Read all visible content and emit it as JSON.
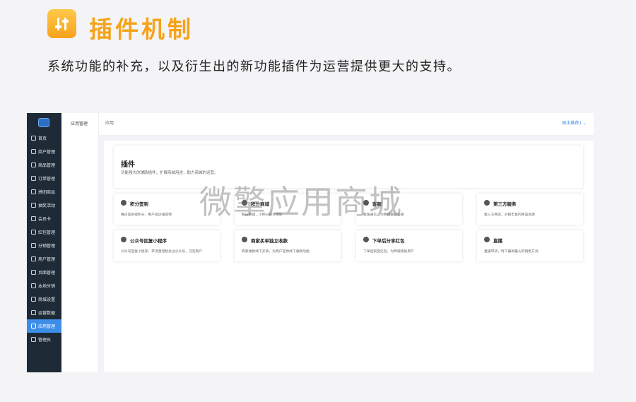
{
  "header": {
    "icon": "sliders-icon",
    "title": "插件机制",
    "subtitle": "系统功能的补充，以及衍生出的新功能插件为运营提供更大的支持。"
  },
  "sidebar": {
    "items": [
      {
        "label": "首页",
        "icon": "home-icon"
      },
      {
        "label": "商户管理",
        "icon": "store-icon"
      },
      {
        "label": "商品管理",
        "icon": "goods-icon"
      },
      {
        "label": "订单管理",
        "icon": "order-icon"
      },
      {
        "label": "拼团商品",
        "icon": "group-icon"
      },
      {
        "label": "抽奖活动",
        "icon": "gift-icon"
      },
      {
        "label": "会员卡",
        "icon": "card-icon"
      },
      {
        "label": "红包管理",
        "icon": "redpacket-icon"
      },
      {
        "label": "分销管理",
        "icon": "distribution-icon"
      },
      {
        "label": "用户管理",
        "icon": "user-icon"
      },
      {
        "label": "页面管理",
        "icon": "page-icon"
      },
      {
        "label": "本地分销",
        "icon": "location-icon"
      },
      {
        "label": "商城设置",
        "icon": "cart-icon"
      },
      {
        "label": "运营数据",
        "icon": "chart-icon"
      },
      {
        "label": "应用管理",
        "icon": "settings-icon",
        "active": true
      },
      {
        "label": "管理员",
        "icon": "admin-icon"
      }
    ]
  },
  "subnav": {
    "label": "应用管理"
  },
  "topbar": {
    "crumb": "应用",
    "store": "固水推荐1 ⌄"
  },
  "plugins": {
    "title": "插件",
    "desc": "功能强大的辅助插件，扩展商城用途，助力商城的运营。",
    "cards": [
      {
        "title": "积分签到",
        "desc": "每日签到得积分，用户签达送得惊"
      },
      {
        "title": "积分商城",
        "desc": "积分商城，小积分有大用处"
      },
      {
        "title": "客服",
        "desc": "极限通信，为商城解疑答惑"
      },
      {
        "title": "第三方服务",
        "desc": "第三方商店，对接丰富的商品资源"
      },
      {
        "title": "公众号回复小程序",
        "desc": "公众号回复小程序，带流量轻松关注公众号，沉淀用户"
      },
      {
        "title": "商家买单独立收款",
        "desc": "商家收款线下买单，为商户提供线下收款功能"
      },
      {
        "title": "下单后分享红包",
        "desc": "下单后裂变红包，为商城增加用户"
      },
      {
        "title": "直播",
        "desc": "直播带货，时下最新最火的销售方式"
      }
    ]
  },
  "watermark": "微擎应用商城",
  "colors": {
    "accent": "#f5a319",
    "sidebar_bg": "#1e2a36",
    "active": "#3d8ee8"
  }
}
